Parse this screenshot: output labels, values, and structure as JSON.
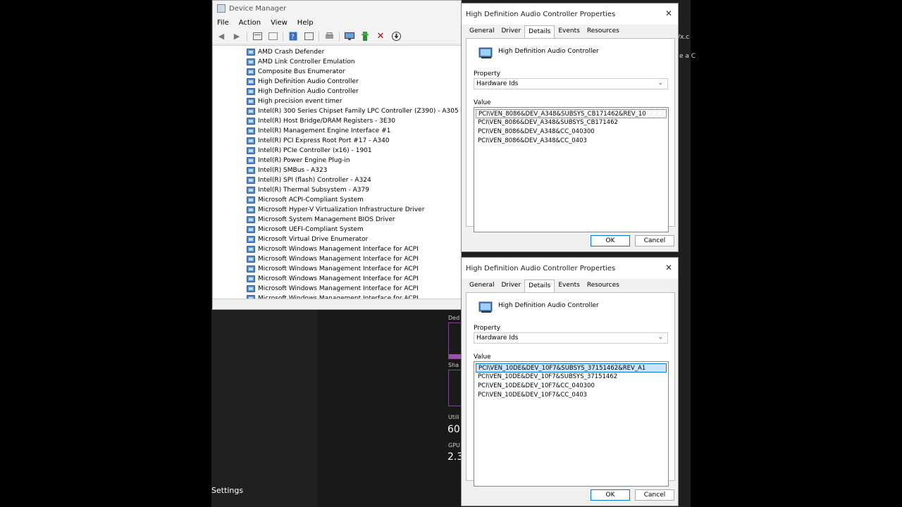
{
  "device_manager": {
    "title": "Device Manager",
    "menu": [
      "File",
      "Action",
      "View",
      "Help"
    ],
    "toolbar_icons": [
      "back-arrow-icon",
      "forward-arrow-icon",
      "properties-icon",
      "show-hidden-icon",
      "help-icon",
      "view-icon",
      "print-icon",
      "monitor-icon",
      "update-driver-icon",
      "uninstall-icon",
      "download-icon"
    ],
    "devices": [
      "AMD Crash Defender",
      "AMD Link Controller Emulation",
      "Composite Bus Enumerator",
      "High Definition Audio Controller",
      "High Definition Audio Controller",
      "High precision event timer",
      "Intel(R) 300 Series Chipset Family LPC Controller (Z390) - A305",
      "Intel(R) Host Bridge/DRAM Registers - 3E30",
      "Intel(R) Management Engine Interface #1",
      "Intel(R) PCI Express Root Port #17 - A340",
      "Intel(R) PCIe Controller (x16) - 1901",
      "Intel(R) Power Engine Plug-in",
      "Intel(R) SMBus - A323",
      "Intel(R) SPI (flash) Controller - A324",
      "Intel(R) Thermal Subsystem - A379",
      "Microsoft ACPI-Compliant System",
      "Microsoft Hyper-V Virtualization Infrastructure Driver",
      "Microsoft System Management BIOS Driver",
      "Microsoft UEFI-Compliant System",
      "Microsoft Virtual Drive Enumerator",
      "Microsoft Windows Management Interface for ACPI",
      "Microsoft Windows Management Interface for ACPI",
      "Microsoft Windows Management Interface for ACPI",
      "Microsoft Windows Management Interface for ACPI",
      "Microsoft Windows Management Interface for ACPI",
      "Microsoft Windows Management Interface for ACPI"
    ]
  },
  "dialog1": {
    "title": "High Definition Audio Controller Properties",
    "tabs": [
      "General",
      "Driver",
      "Details",
      "Events",
      "Resources"
    ],
    "device_name": "High Definition Audio Controller",
    "property_label": "Property",
    "property_value": "Hardware Ids",
    "value_label": "Value",
    "values": [
      "PCI\\VEN_8086&DEV_A348&SUBSYS_CB171462&REV_10",
      "PCI\\VEN_8086&DEV_A348&SUBSYS_CB171462",
      "PCI\\VEN_8086&DEV_A348&CC_040300",
      "PCI\\VEN_8086&DEV_A348&CC_0403"
    ],
    "ok": "OK",
    "cancel": "Cancel"
  },
  "dialog2": {
    "title": "High Definition Audio Controller Properties",
    "tabs": [
      "General",
      "Driver",
      "Details",
      "Events",
      "Resources"
    ],
    "device_name": "High Definition Audio Controller",
    "property_label": "Property",
    "property_value": "Hardware Ids",
    "value_label": "Value",
    "values": [
      "PCI\\VEN_10DE&DEV_10F7&SUBSYS_37151462&REV_A1",
      "PCI\\VEN_10DE&DEV_10F7&SUBSYS_37151462",
      "PCI\\VEN_10DE&DEV_10F7&CC_040300",
      "PCI\\VEN_10DE&DEV_10F7&CC_0403"
    ],
    "ok": "OK",
    "cancel": "Cancel"
  },
  "task_manager": {
    "dedicated_label": "Ded",
    "shared_label": "Sha",
    "utilization_label": "Utili",
    "utilization_value": "60",
    "gpu_label": "GPU",
    "gpu_value": "2.3",
    "dedicated_fill_fraction": 0.13,
    "bar_color": "#9b4fb0"
  },
  "background_text": {
    "url_fragment": "/x.c",
    "line_fragment": "e a C"
  },
  "settings_label": "Settings"
}
